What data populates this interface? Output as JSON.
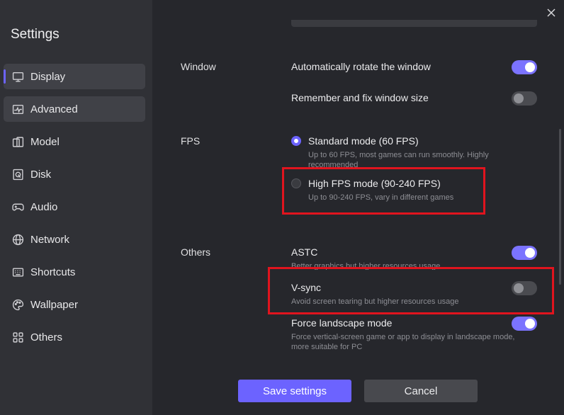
{
  "sidebar": {
    "title": "Settings",
    "items": [
      {
        "label": "Display",
        "icon": "monitor-icon"
      },
      {
        "label": "Advanced",
        "icon": "pulse-icon"
      },
      {
        "label": "Model",
        "icon": "phone-icon"
      },
      {
        "label": "Disk",
        "icon": "disk-icon"
      },
      {
        "label": "Audio",
        "icon": "gamepad-icon"
      },
      {
        "label": "Network",
        "icon": "globe-icon"
      },
      {
        "label": "Shortcuts",
        "icon": "keyboard-icon"
      },
      {
        "label": "Wallpaper",
        "icon": "palette-icon"
      },
      {
        "label": "Others",
        "icon": "grid-icon"
      }
    ]
  },
  "window": {
    "section_label": "Window",
    "auto_rotate": {
      "label": "Automatically rotate the window",
      "enabled": true
    },
    "remember_size": {
      "label": "Remember and fix window size",
      "enabled": false
    }
  },
  "fps": {
    "section_label": "FPS",
    "standard": {
      "label": "Standard mode (60 FPS)",
      "desc_line1": "Up to 60 FPS, most games can run smoothly. Highly",
      "desc_line2": "recommended",
      "selected": true
    },
    "high": {
      "label": "High FPS mode (90-240 FPS)",
      "desc": "Up to 90-240 FPS, vary in different games",
      "selected": false
    }
  },
  "others": {
    "section_label": "Others",
    "astc": {
      "label": "ASTC",
      "desc": "Better graphics but higher resources usage",
      "enabled": true
    },
    "vsync": {
      "label": "V-sync",
      "desc": "Avoid screen tearing but higher resources usage",
      "enabled": false
    },
    "force_landscape": {
      "label": "Force landscape mode",
      "desc_line1": "Force vertical-screen game or app to display in landscape mode,",
      "desc_line2": "more suitable for PC",
      "enabled": true
    }
  },
  "buttons": {
    "save": "Save settings",
    "cancel": "Cancel"
  },
  "colors": {
    "accent": "#6c63ff",
    "highlight": "#e0141e",
    "sidebar_bg": "#303136",
    "main_bg": "#26272c"
  }
}
